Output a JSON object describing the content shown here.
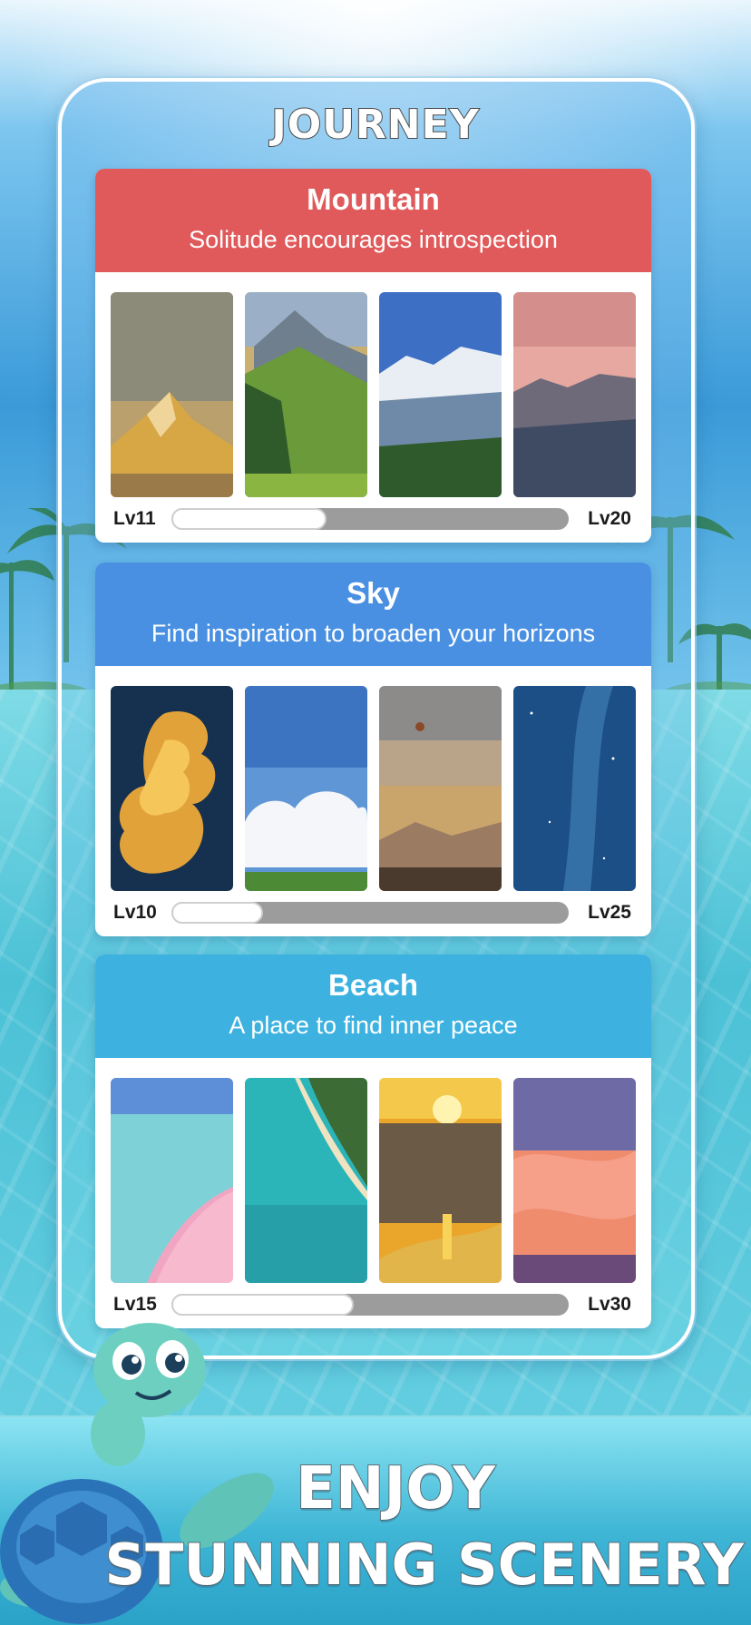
{
  "header": {
    "title": "JOURNEY"
  },
  "cards": [
    {
      "title": "Mountain",
      "subtitle": "Solitude encourages introspection",
      "header_color": "#e05a5b",
      "level_start": "Lv11",
      "level_end": "Lv20",
      "progress": 0.39,
      "scenes": [
        "golden-peak-image",
        "green-alpine-valley-image",
        "snowy-range-image",
        "pink-dusk-mountains-image"
      ]
    },
    {
      "title": "Sky",
      "subtitle": "Find inspiration to broaden your horizons",
      "header_color": "#4a90e2",
      "level_start": "Lv10",
      "level_end": "Lv25",
      "progress": 0.23,
      "scenes": [
        "golden-storm-cloud-image",
        "white-clouds-meadow-image",
        "hot-air-balloon-sky-image",
        "milky-way-image"
      ]
    },
    {
      "title": "Beach",
      "subtitle": "A place to find inner peace",
      "header_color": "#3db2e0",
      "level_start": "Lv15",
      "level_end": "Lv30",
      "progress": 0.46,
      "scenes": [
        "pink-sand-beach-image",
        "turquoise-coast-aerial-image",
        "sea-sunset-image",
        "sunset-sky-image"
      ]
    }
  ],
  "promo": {
    "line1": "ENJOY",
    "line2": "STUNNING SCENERY"
  },
  "colors": {
    "frame_border": "#ffffff",
    "progress_track": "#9c9c9c",
    "progress_fill": "#ffffff"
  }
}
